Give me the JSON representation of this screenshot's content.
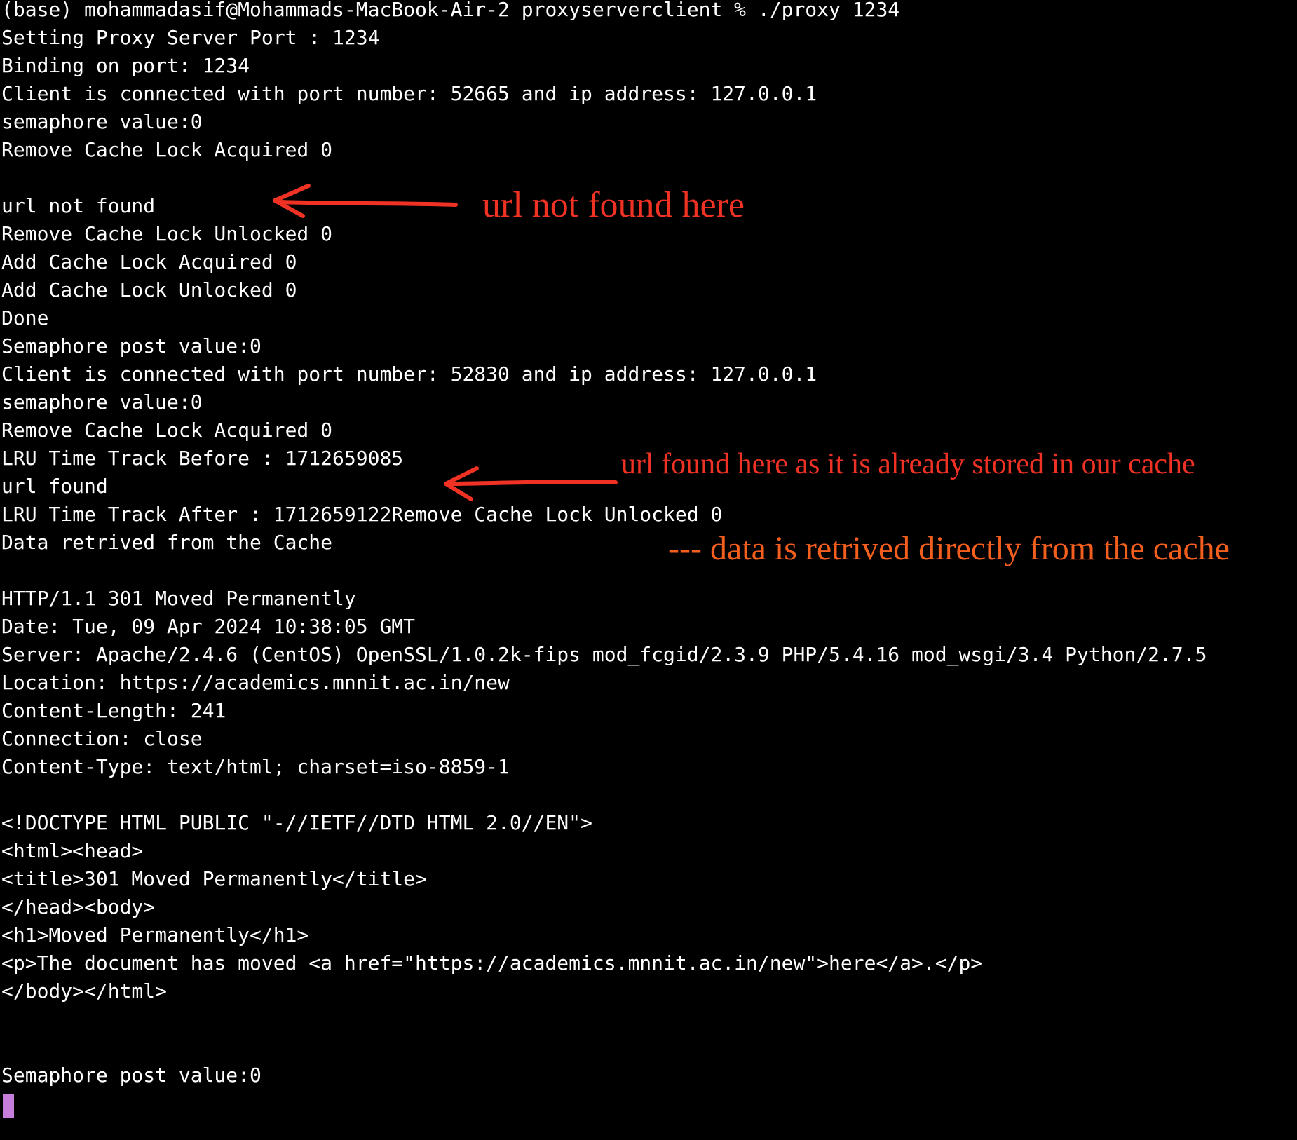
{
  "terminal": {
    "lines": [
      "(base) mohammadasif@Mohammads-MacBook-Air-2 proxyserverclient % ./proxy 1234",
      "Setting Proxy Server Port : 1234",
      "Binding on port: 1234",
      "Client is connected with port number: 52665 and ip address: 127.0.0.1",
      "semaphore value:0",
      "Remove Cache Lock Acquired 0",
      "",
      "url not found",
      "Remove Cache Lock Unlocked 0",
      "Add Cache Lock Acquired 0",
      "Add Cache Lock Unlocked 0",
      "Done",
      "Semaphore post value:0",
      "Client is connected with port number: 52830 and ip address: 127.0.0.1",
      "semaphore value:0",
      "Remove Cache Lock Acquired 0",
      "LRU Time Track Before : 1712659085",
      "url found",
      "LRU Time Track After : 1712659122Remove Cache Lock Unlocked 0",
      "Data retrived from the Cache",
      "",
      "HTTP/1.1 301 Moved Permanently",
      "Date: Tue, 09 Apr 2024 10:38:05 GMT",
      "Server: Apache/2.4.6 (CentOS) OpenSSL/1.0.2k-fips mod_fcgid/2.3.9 PHP/5.4.16 mod_wsgi/3.4 Python/2.7.5",
      "Location: https://academics.mnnit.ac.in/new",
      "Content-Length: 241",
      "Connection: close",
      "Content-Type: text/html; charset=iso-8859-1",
      "",
      "<!DOCTYPE HTML PUBLIC \"-//IETF//DTD HTML 2.0//EN\">",
      "<html><head>",
      "<title>301 Moved Permanently</title>",
      "</head><body>",
      "<h1>Moved Permanently</h1>",
      "<p>The document has moved <a href=\"https://academics.mnnit.ac.in/new\">here</a>.</p>",
      "</body></html>",
      "",
      "",
      "Semaphore post value:0"
    ]
  },
  "annotations": {
    "url_not_found": "url not found here",
    "url_found": "url found here as it is already stored in our cache",
    "data_cache": "--- data is retrived directly from the cache"
  },
  "colors": {
    "background": "#000000",
    "text": "#ffffff",
    "cursor": "#c77ddb",
    "annotation_red": "#f03224",
    "annotation_orange": "#f55f1e"
  }
}
